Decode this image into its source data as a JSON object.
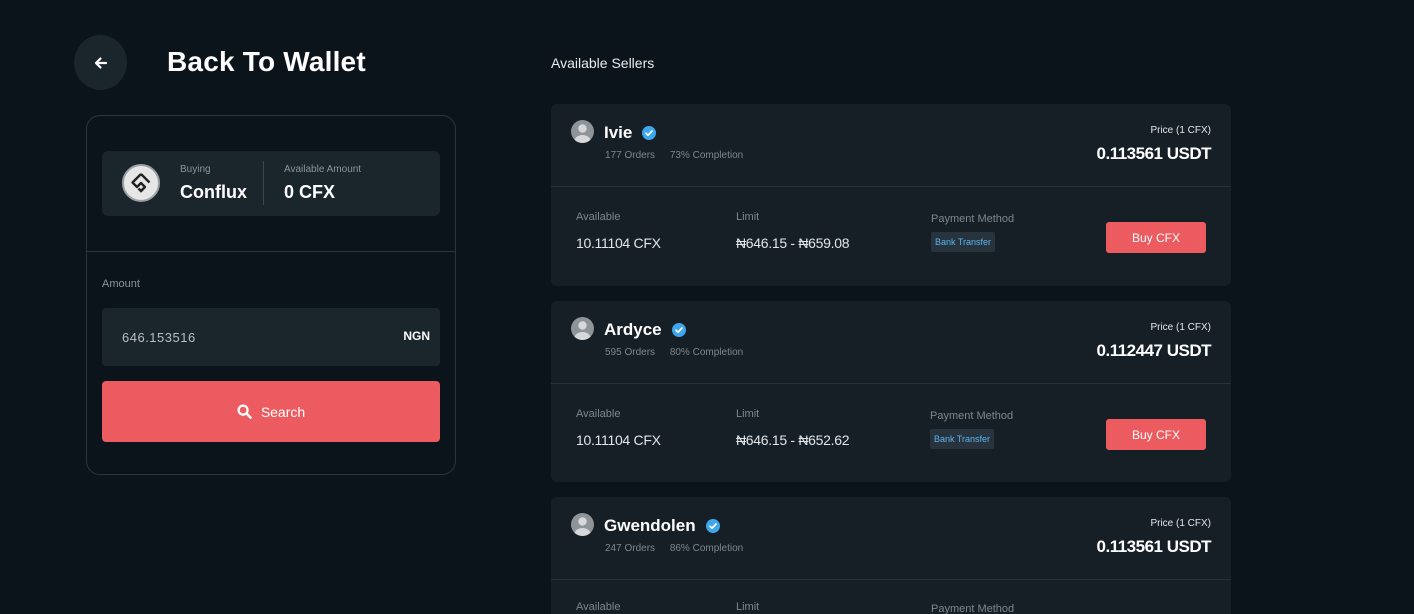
{
  "header": {
    "back_title": "Back To Wallet"
  },
  "buy_form": {
    "buying_label": "Buying",
    "buying_value": "Conflux",
    "available_label": "Available Amount",
    "available_value": "0 CFX",
    "amount_label": "Amount",
    "amount_value": "646.153516",
    "currency": "NGN",
    "search_label": "Search"
  },
  "sellers": {
    "title": "Available Sellers",
    "items": [
      {
        "name": "Ivie",
        "orders": "177 Orders",
        "completion": "73% Completion",
        "price_label": "Price (1 CFX)",
        "price": "0.113561 USDT",
        "available_label": "Available",
        "available": "10.11104 CFX",
        "limit_label": "Limit",
        "limit": "₦646.15 - ₦659.08",
        "payment_label": "Payment Method",
        "payment": "Bank Transfer",
        "buy_label": "Buy CFX"
      },
      {
        "name": "Ardyce",
        "orders": "595 Orders",
        "completion": "80% Completion",
        "price_label": "Price (1 CFX)",
        "price": "0.112447 USDT",
        "available_label": "Available",
        "available": "10.11104 CFX",
        "limit_label": "Limit",
        "limit": "₦646.15 - ₦652.62",
        "payment_label": "Payment Method",
        "payment": "Bank Transfer",
        "buy_label": "Buy CFX"
      },
      {
        "name": "Gwendolen",
        "orders": "247 Orders",
        "completion": "86% Completion",
        "price_label": "Price (1 CFX)",
        "price": "0.113561 USDT",
        "available_label": "Available",
        "limit_label": "Limit",
        "payment_label": "Payment Method"
      }
    ]
  },
  "colors": {
    "background": "#0b141a",
    "accent": "#ec5b5f",
    "verified": "#3ea6ec",
    "badge_text": "#5cb3f0"
  },
  "icons": {
    "back": "arrow-left-icon",
    "search": "search-icon",
    "verified": "verified-badge-icon",
    "avatar": "user-avatar-icon",
    "coin": "conflux-logo-icon"
  }
}
